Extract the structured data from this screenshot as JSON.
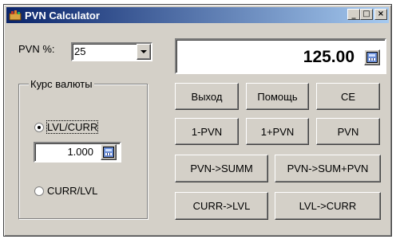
{
  "window": {
    "title": "PVN Calculator",
    "min_glyph": "_",
    "max_glyph": "□",
    "close_glyph": "×"
  },
  "pvn": {
    "label": "PVN %:",
    "selected": "25"
  },
  "result": {
    "value": "125.00"
  },
  "currency_group": {
    "label": "Курс валюты",
    "option_lvl_curr": "LVL/CURR",
    "option_curr_lvl": "CURR/LVL",
    "selected_option": "LVL/CURR",
    "rate_value": "1.000"
  },
  "buttons": {
    "exit": "Выход",
    "help": "Помощь",
    "ce": "CE",
    "one_minus_pvn": "1-PVN",
    "one_plus_pvn": "1+PVN",
    "pvn": "PVN",
    "pvn_to_summ": "PVN->SUMM",
    "pvn_to_sum_plus_pvn": "PVN->SUM+PVN",
    "curr_to_lvl": "CURR->LVL",
    "lvl_to_curr": "LVL->CURR"
  }
}
